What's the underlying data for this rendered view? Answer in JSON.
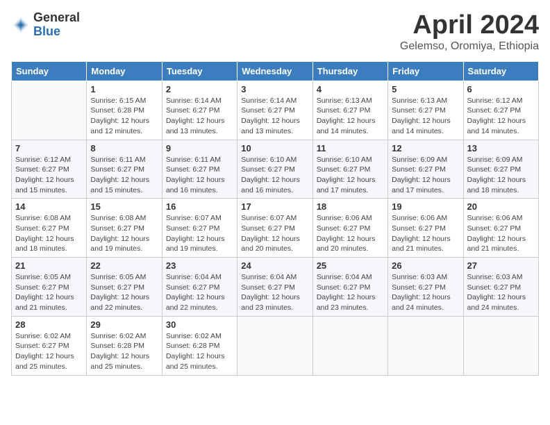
{
  "logo": {
    "general": "General",
    "blue": "Blue"
  },
  "title": "April 2024",
  "location": "Gelemso, Oromiya, Ethiopia",
  "weekdays": [
    "Sunday",
    "Monday",
    "Tuesday",
    "Wednesday",
    "Thursday",
    "Friday",
    "Saturday"
  ],
  "weeks": [
    [
      {
        "day": "",
        "info": ""
      },
      {
        "day": "1",
        "info": "Sunrise: 6:15 AM\nSunset: 6:28 PM\nDaylight: 12 hours\nand 12 minutes."
      },
      {
        "day": "2",
        "info": "Sunrise: 6:14 AM\nSunset: 6:27 PM\nDaylight: 12 hours\nand 13 minutes."
      },
      {
        "day": "3",
        "info": "Sunrise: 6:14 AM\nSunset: 6:27 PM\nDaylight: 12 hours\nand 13 minutes."
      },
      {
        "day": "4",
        "info": "Sunrise: 6:13 AM\nSunset: 6:27 PM\nDaylight: 12 hours\nand 14 minutes."
      },
      {
        "day": "5",
        "info": "Sunrise: 6:13 AM\nSunset: 6:27 PM\nDaylight: 12 hours\nand 14 minutes."
      },
      {
        "day": "6",
        "info": "Sunrise: 6:12 AM\nSunset: 6:27 PM\nDaylight: 12 hours\nand 14 minutes."
      }
    ],
    [
      {
        "day": "7",
        "info": "Sunrise: 6:12 AM\nSunset: 6:27 PM\nDaylight: 12 hours\nand 15 minutes."
      },
      {
        "day": "8",
        "info": "Sunrise: 6:11 AM\nSunset: 6:27 PM\nDaylight: 12 hours\nand 15 minutes."
      },
      {
        "day": "9",
        "info": "Sunrise: 6:11 AM\nSunset: 6:27 PM\nDaylight: 12 hours\nand 16 minutes."
      },
      {
        "day": "10",
        "info": "Sunrise: 6:10 AM\nSunset: 6:27 PM\nDaylight: 12 hours\nand 16 minutes."
      },
      {
        "day": "11",
        "info": "Sunrise: 6:10 AM\nSunset: 6:27 PM\nDaylight: 12 hours\nand 17 minutes."
      },
      {
        "day": "12",
        "info": "Sunrise: 6:09 AM\nSunset: 6:27 PM\nDaylight: 12 hours\nand 17 minutes."
      },
      {
        "day": "13",
        "info": "Sunrise: 6:09 AM\nSunset: 6:27 PM\nDaylight: 12 hours\nand 18 minutes."
      }
    ],
    [
      {
        "day": "14",
        "info": "Sunrise: 6:08 AM\nSunset: 6:27 PM\nDaylight: 12 hours\nand 18 minutes."
      },
      {
        "day": "15",
        "info": "Sunrise: 6:08 AM\nSunset: 6:27 PM\nDaylight: 12 hours\nand 19 minutes."
      },
      {
        "day": "16",
        "info": "Sunrise: 6:07 AM\nSunset: 6:27 PM\nDaylight: 12 hours\nand 19 minutes."
      },
      {
        "day": "17",
        "info": "Sunrise: 6:07 AM\nSunset: 6:27 PM\nDaylight: 12 hours\nand 20 minutes."
      },
      {
        "day": "18",
        "info": "Sunrise: 6:06 AM\nSunset: 6:27 PM\nDaylight: 12 hours\nand 20 minutes."
      },
      {
        "day": "19",
        "info": "Sunrise: 6:06 AM\nSunset: 6:27 PM\nDaylight: 12 hours\nand 21 minutes."
      },
      {
        "day": "20",
        "info": "Sunrise: 6:06 AM\nSunset: 6:27 PM\nDaylight: 12 hours\nand 21 minutes."
      }
    ],
    [
      {
        "day": "21",
        "info": "Sunrise: 6:05 AM\nSunset: 6:27 PM\nDaylight: 12 hours\nand 21 minutes."
      },
      {
        "day": "22",
        "info": "Sunrise: 6:05 AM\nSunset: 6:27 PM\nDaylight: 12 hours\nand 22 minutes."
      },
      {
        "day": "23",
        "info": "Sunrise: 6:04 AM\nSunset: 6:27 PM\nDaylight: 12 hours\nand 22 minutes."
      },
      {
        "day": "24",
        "info": "Sunrise: 6:04 AM\nSunset: 6:27 PM\nDaylight: 12 hours\nand 23 minutes."
      },
      {
        "day": "25",
        "info": "Sunrise: 6:04 AM\nSunset: 6:27 PM\nDaylight: 12 hours\nand 23 minutes."
      },
      {
        "day": "26",
        "info": "Sunrise: 6:03 AM\nSunset: 6:27 PM\nDaylight: 12 hours\nand 24 minutes."
      },
      {
        "day": "27",
        "info": "Sunrise: 6:03 AM\nSunset: 6:27 PM\nDaylight: 12 hours\nand 24 minutes."
      }
    ],
    [
      {
        "day": "28",
        "info": "Sunrise: 6:02 AM\nSunset: 6:27 PM\nDaylight: 12 hours\nand 25 minutes."
      },
      {
        "day": "29",
        "info": "Sunrise: 6:02 AM\nSunset: 6:28 PM\nDaylight: 12 hours\nand 25 minutes."
      },
      {
        "day": "30",
        "info": "Sunrise: 6:02 AM\nSunset: 6:28 PM\nDaylight: 12 hours\nand 25 minutes."
      },
      {
        "day": "",
        "info": ""
      },
      {
        "day": "",
        "info": ""
      },
      {
        "day": "",
        "info": ""
      },
      {
        "day": "",
        "info": ""
      }
    ]
  ]
}
